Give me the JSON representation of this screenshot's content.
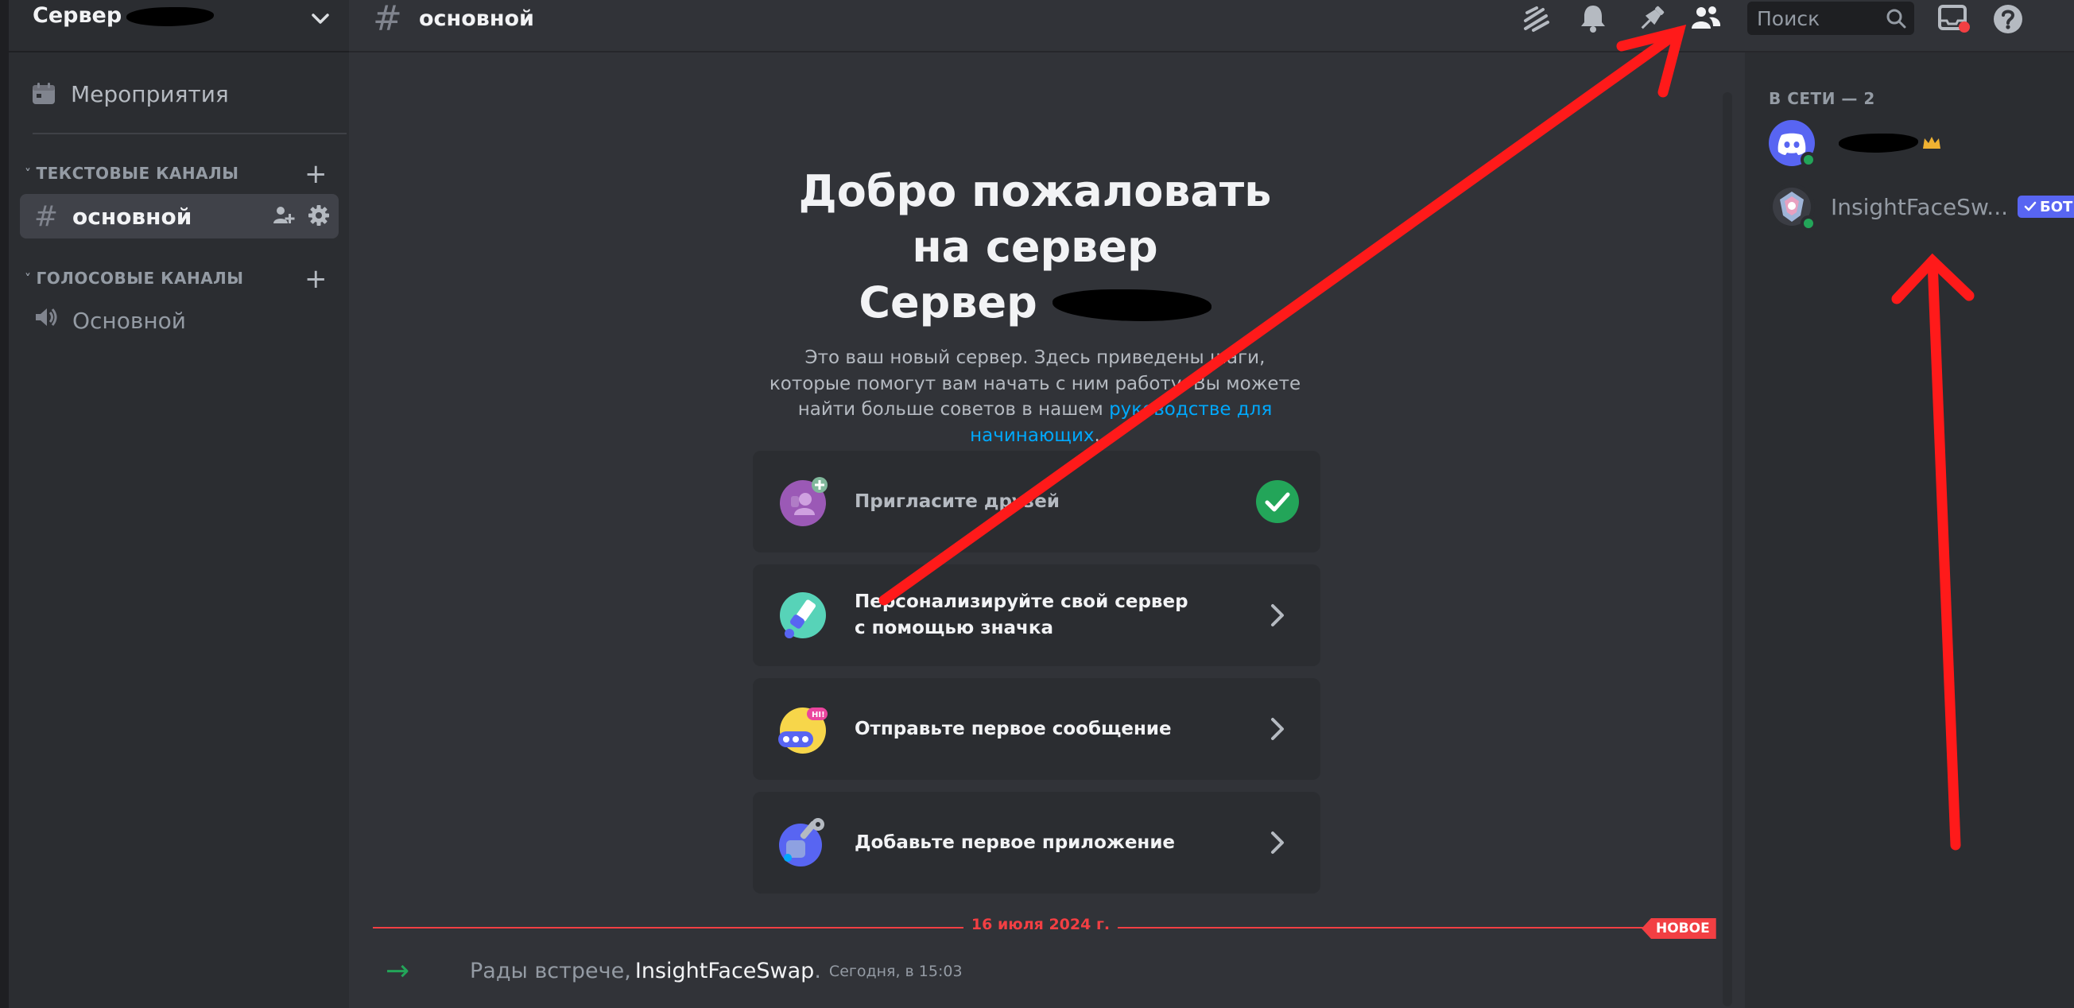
{
  "sidebar": {
    "server_name": "Сервер",
    "events_label": "Мероприятия",
    "text_category": "ТЕКСТОВЫЕ КАНАЛЫ",
    "voice_category": "ГОЛОСОВЫЕ КАНАЛЫ",
    "text_channels": [
      {
        "label": "основной"
      }
    ],
    "voice_channels": [
      {
        "label": "Основной"
      }
    ]
  },
  "topbar": {
    "channel_name": "основной",
    "search_placeholder": "Поиск"
  },
  "welcome": {
    "title": "Добро пожаловать на сервер",
    "title_server": "Сервер",
    "description": "Это ваш новый сервер. Здесь приведены шаги, которые помогут вам начать с ним работу. Вы можете найти больше советов в нашем",
    "link_text": "руководстве для начинающих",
    "link_suffix": "."
  },
  "cards": [
    {
      "label": "Пригласите друзей",
      "done": true
    },
    {
      "label": "Персонализируйте свой сервер с помощью значка",
      "done": false
    },
    {
      "label": "Отправьте первое сообщение",
      "done": false
    },
    {
      "label": "Добавьте первое приложение",
      "done": false
    }
  ],
  "divider": {
    "date": "16 июля 2024 г.",
    "new_badge": "НОВОЕ"
  },
  "system_message": {
    "prefix": "Рады встрече,",
    "username": "InsightFaceSwap",
    "suffix": ".",
    "timestamp": "Сегодня, в 15:03"
  },
  "members": {
    "header": "В СЕТИ — 2",
    "list": [
      {
        "name": "",
        "owner": true,
        "status": "online"
      },
      {
        "name": "InsightFaceSw...",
        "bot_badge": "БОТ",
        "status": "online"
      }
    ]
  },
  "colors": {
    "accent_blurple": "#5865f2",
    "online_green": "#23a559",
    "danger_red": "#f23f43",
    "link_blue": "#00a8fc",
    "annotation_red": "#ff1a1a"
  },
  "icons": [
    "events-calendar-icon",
    "hash-icon",
    "speaker-icon",
    "add-member-icon",
    "gear-icon",
    "threads-icon",
    "bell-icon",
    "pin-icon",
    "members-icon",
    "search-icon",
    "inbox-icon",
    "help-icon",
    "check-icon",
    "chevron-right-icon",
    "join-arrow-icon",
    "crown-icon",
    "bot-check-icon"
  ]
}
